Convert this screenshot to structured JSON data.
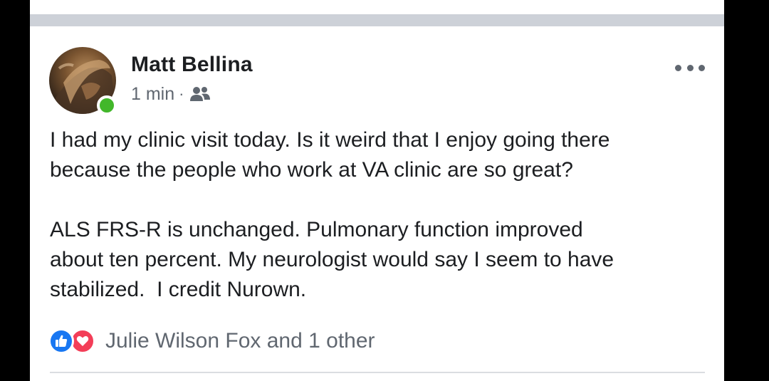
{
  "post": {
    "author": "Matt Bellina",
    "timestamp": "1 min",
    "separator": "·",
    "audience_icon": "friends-icon",
    "paragraphs": [
      "I had my clinic visit today. Is it weird that I enjoy going there\nbecause the people who work at VA clinic are so great?",
      "ALS FRS-R is unchanged. Pulmonary function improved\nabout ten percent. My neurologist would say I seem to have\nstabilized.  I credit Nurown."
    ],
    "reactions": {
      "icons": [
        "like-icon",
        "love-icon"
      ],
      "summary": "Julie Wilson Fox and 1 other"
    }
  },
  "colors": {
    "online": "#42b72a",
    "like": "#1877f2",
    "love": "#f33e58",
    "secondary_text": "#606770",
    "primary_text": "#1c1e21"
  }
}
